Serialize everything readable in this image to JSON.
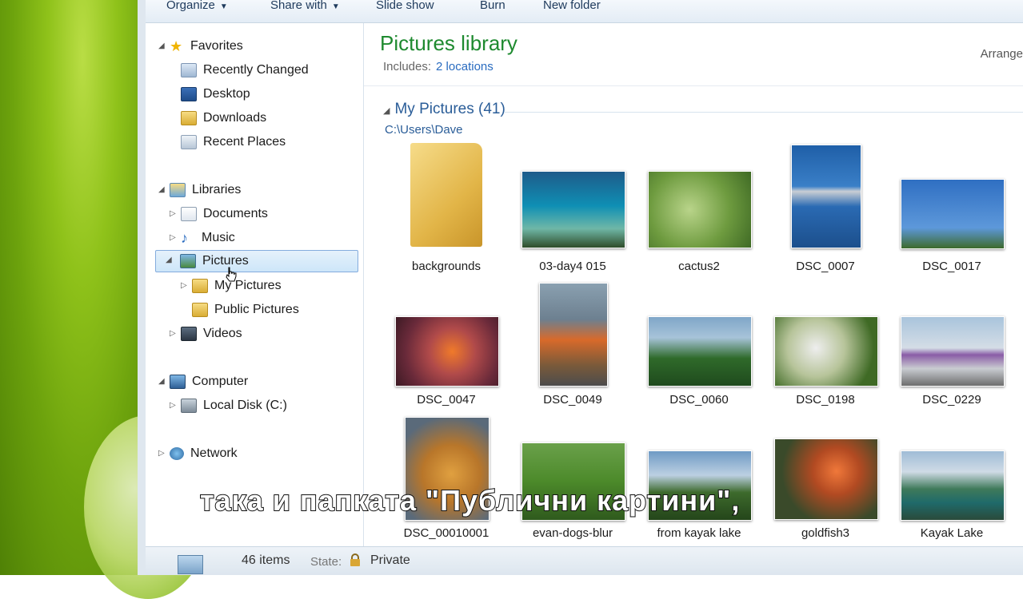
{
  "toolbar": {
    "organize": "Organize",
    "share_with": "Share with",
    "slide_show": "Slide show",
    "burn": "Burn",
    "new_folder": "New folder"
  },
  "nav": {
    "favorites": "Favorites",
    "recently_changed": "Recently Changed",
    "desktop": "Desktop",
    "downloads": "Downloads",
    "recent_places": "Recent Places",
    "libraries": "Libraries",
    "documents": "Documents",
    "music": "Music",
    "pictures": "Pictures",
    "my_pictures": "My Pictures",
    "public_pictures": "Public Pictures",
    "videos": "Videos",
    "computer": "Computer",
    "local_disk": "Local Disk (C:)",
    "network": "Network"
  },
  "library": {
    "title": "Pictures library",
    "includes_label": "Includes:",
    "locations_link": "2 locations",
    "arrange_label": "Arrange",
    "group_header": "My Pictures (41)",
    "group_path": "C:\\Users\\Dave"
  },
  "items": [
    {
      "label": "backgrounds"
    },
    {
      "label": "03-day4 015"
    },
    {
      "label": "cactus2"
    },
    {
      "label": "DSC_0007"
    },
    {
      "label": "DSC_0017"
    },
    {
      "label": "DSC_0047"
    },
    {
      "label": "DSC_0049"
    },
    {
      "label": "DSC_0060"
    },
    {
      "label": "DSC_0198"
    },
    {
      "label": "DSC_0229"
    },
    {
      "label": "DSC_00010001"
    },
    {
      "label": "evan-dogs-blur"
    },
    {
      "label": "from kayak lake"
    },
    {
      "label": "goldfish3"
    },
    {
      "label": "Kayak Lake"
    }
  ],
  "status": {
    "count": "46 items",
    "state_label": "State:",
    "state_value": "Private"
  },
  "subtitle": "така и папката \"Публични картини\",",
  "colors": {
    "library_title": "#1e8a2f",
    "link": "#2a6cc0",
    "selection": "#cde6f9"
  }
}
